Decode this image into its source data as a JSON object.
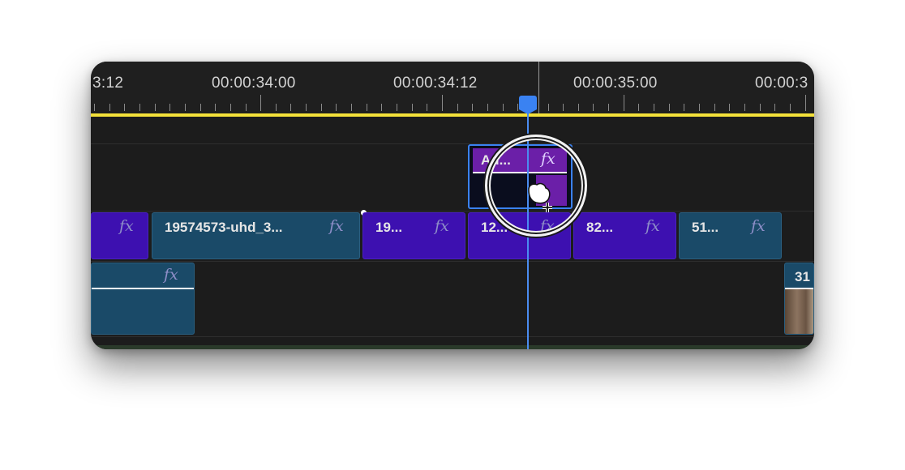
{
  "ruler": {
    "timecodes": [
      "3:12",
      "00:00:34:00",
      "00:00:34:12",
      "00:00:35:00",
      "00:00:3"
    ]
  },
  "tracks": {
    "v3": {
      "clip": {
        "label": "Ad...",
        "fx": "fx"
      }
    },
    "v2": {
      "clips": [
        {
          "label": "",
          "fx": "fx"
        },
        {
          "label": "19574573-uhd_3...",
          "fx": "fx"
        },
        {
          "label": "19...",
          "fx": "fx"
        },
        {
          "label": "12...",
          "fx": "fx"
        },
        {
          "label": "82...",
          "fx": "fx"
        },
        {
          "label": "51...",
          "fx": "fx"
        }
      ]
    },
    "v1": {
      "clips": [
        {
          "label": "",
          "fx": "fx"
        },
        {
          "label": "31",
          "fx": ""
        }
      ]
    }
  },
  "colors": {
    "accent": "#3a82f2",
    "work_area": "#f4e13a",
    "clip_purple": "#3d10b0",
    "clip_teal": "#1a4a68",
    "adjustment_clip": "#6b1fa8"
  },
  "cursor": {
    "icon": "grab-hand-icon"
  }
}
